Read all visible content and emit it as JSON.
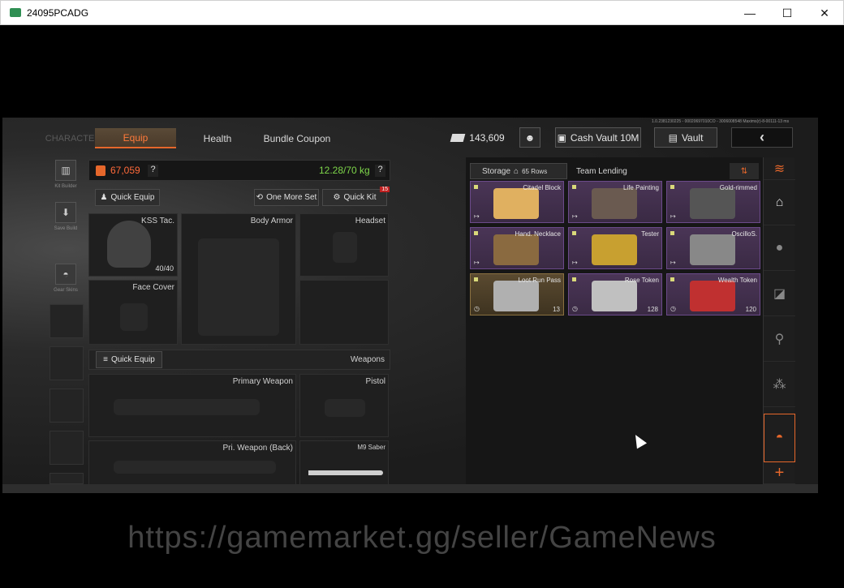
{
  "window": {
    "title": "24095PCADG",
    "minimize": "—",
    "maximize": "☐",
    "close": "✕"
  },
  "tabs": {
    "character": "CHARACTER",
    "equip": "Equip",
    "health": "Health",
    "bundle": "Bundle Coupon"
  },
  "top": {
    "currency": "143,609",
    "cash_vault": "Cash Vault 10M",
    "vault": "Vault",
    "back": "‹",
    "tiny": "1.0.2381230225 - 00020697010CO - 3006008548 Maxims(r)-8-00111-13 ms"
  },
  "left_side": {
    "kit_builder": "Kit Builder",
    "save_build": "Save Build",
    "gear_skins": "Gear Skins"
  },
  "loadout": {
    "value": "67,059",
    "help": "?",
    "weight": "12.28/70 kg",
    "weight_help": "?"
  },
  "armor_section": {
    "quick_equip": "Quick Equip",
    "one_more_set": "One More Set",
    "quick_kit": "Quick Kit",
    "badge": "15"
  },
  "slots": {
    "helmet": "KSS Tac.",
    "helmet_dur": "40/40",
    "body_armor": "Body Armor",
    "headset": "Headset",
    "face_cover": "Face Cover"
  },
  "weapons_section": {
    "quick_equip": "Quick Equip",
    "title": "Weapons"
  },
  "weapon_slots": {
    "primary": "Primary Weapon",
    "pistol": "Pistol",
    "pri_back": "Pri. Weapon (Back)",
    "melee": "M9 Saber"
  },
  "storage": {
    "tab": "Storage",
    "rows": "65 Rows",
    "team_lending": "Team Lending"
  },
  "items": [
    {
      "name": "Citadel Block",
      "qty": "",
      "color": "#e0b060"
    },
    {
      "name": "Life Painting",
      "qty": "",
      "color": "#6a5a50"
    },
    {
      "name": "Gold-rimmed",
      "qty": "",
      "color": "#555555"
    },
    {
      "name": "Hand. Necklace",
      "qty": "",
      "color": "#8a6a40"
    },
    {
      "name": "Tester",
      "qty": "",
      "color": "#c8a030"
    },
    {
      "name": "OscilloS.",
      "qty": "",
      "color": "#888888"
    },
    {
      "name": "Loot Run Pass",
      "qty": "13",
      "color": "#b0b0b0"
    },
    {
      "name": "Rose Token",
      "qty": "128",
      "color": "#c0c0c0"
    },
    {
      "name": "Wealth Token",
      "qty": "120",
      "color": "#c03030"
    }
  ],
  "rnav": {
    "plus": "+"
  },
  "watermark": "https://gamemarket.gg/seller/GameNews"
}
